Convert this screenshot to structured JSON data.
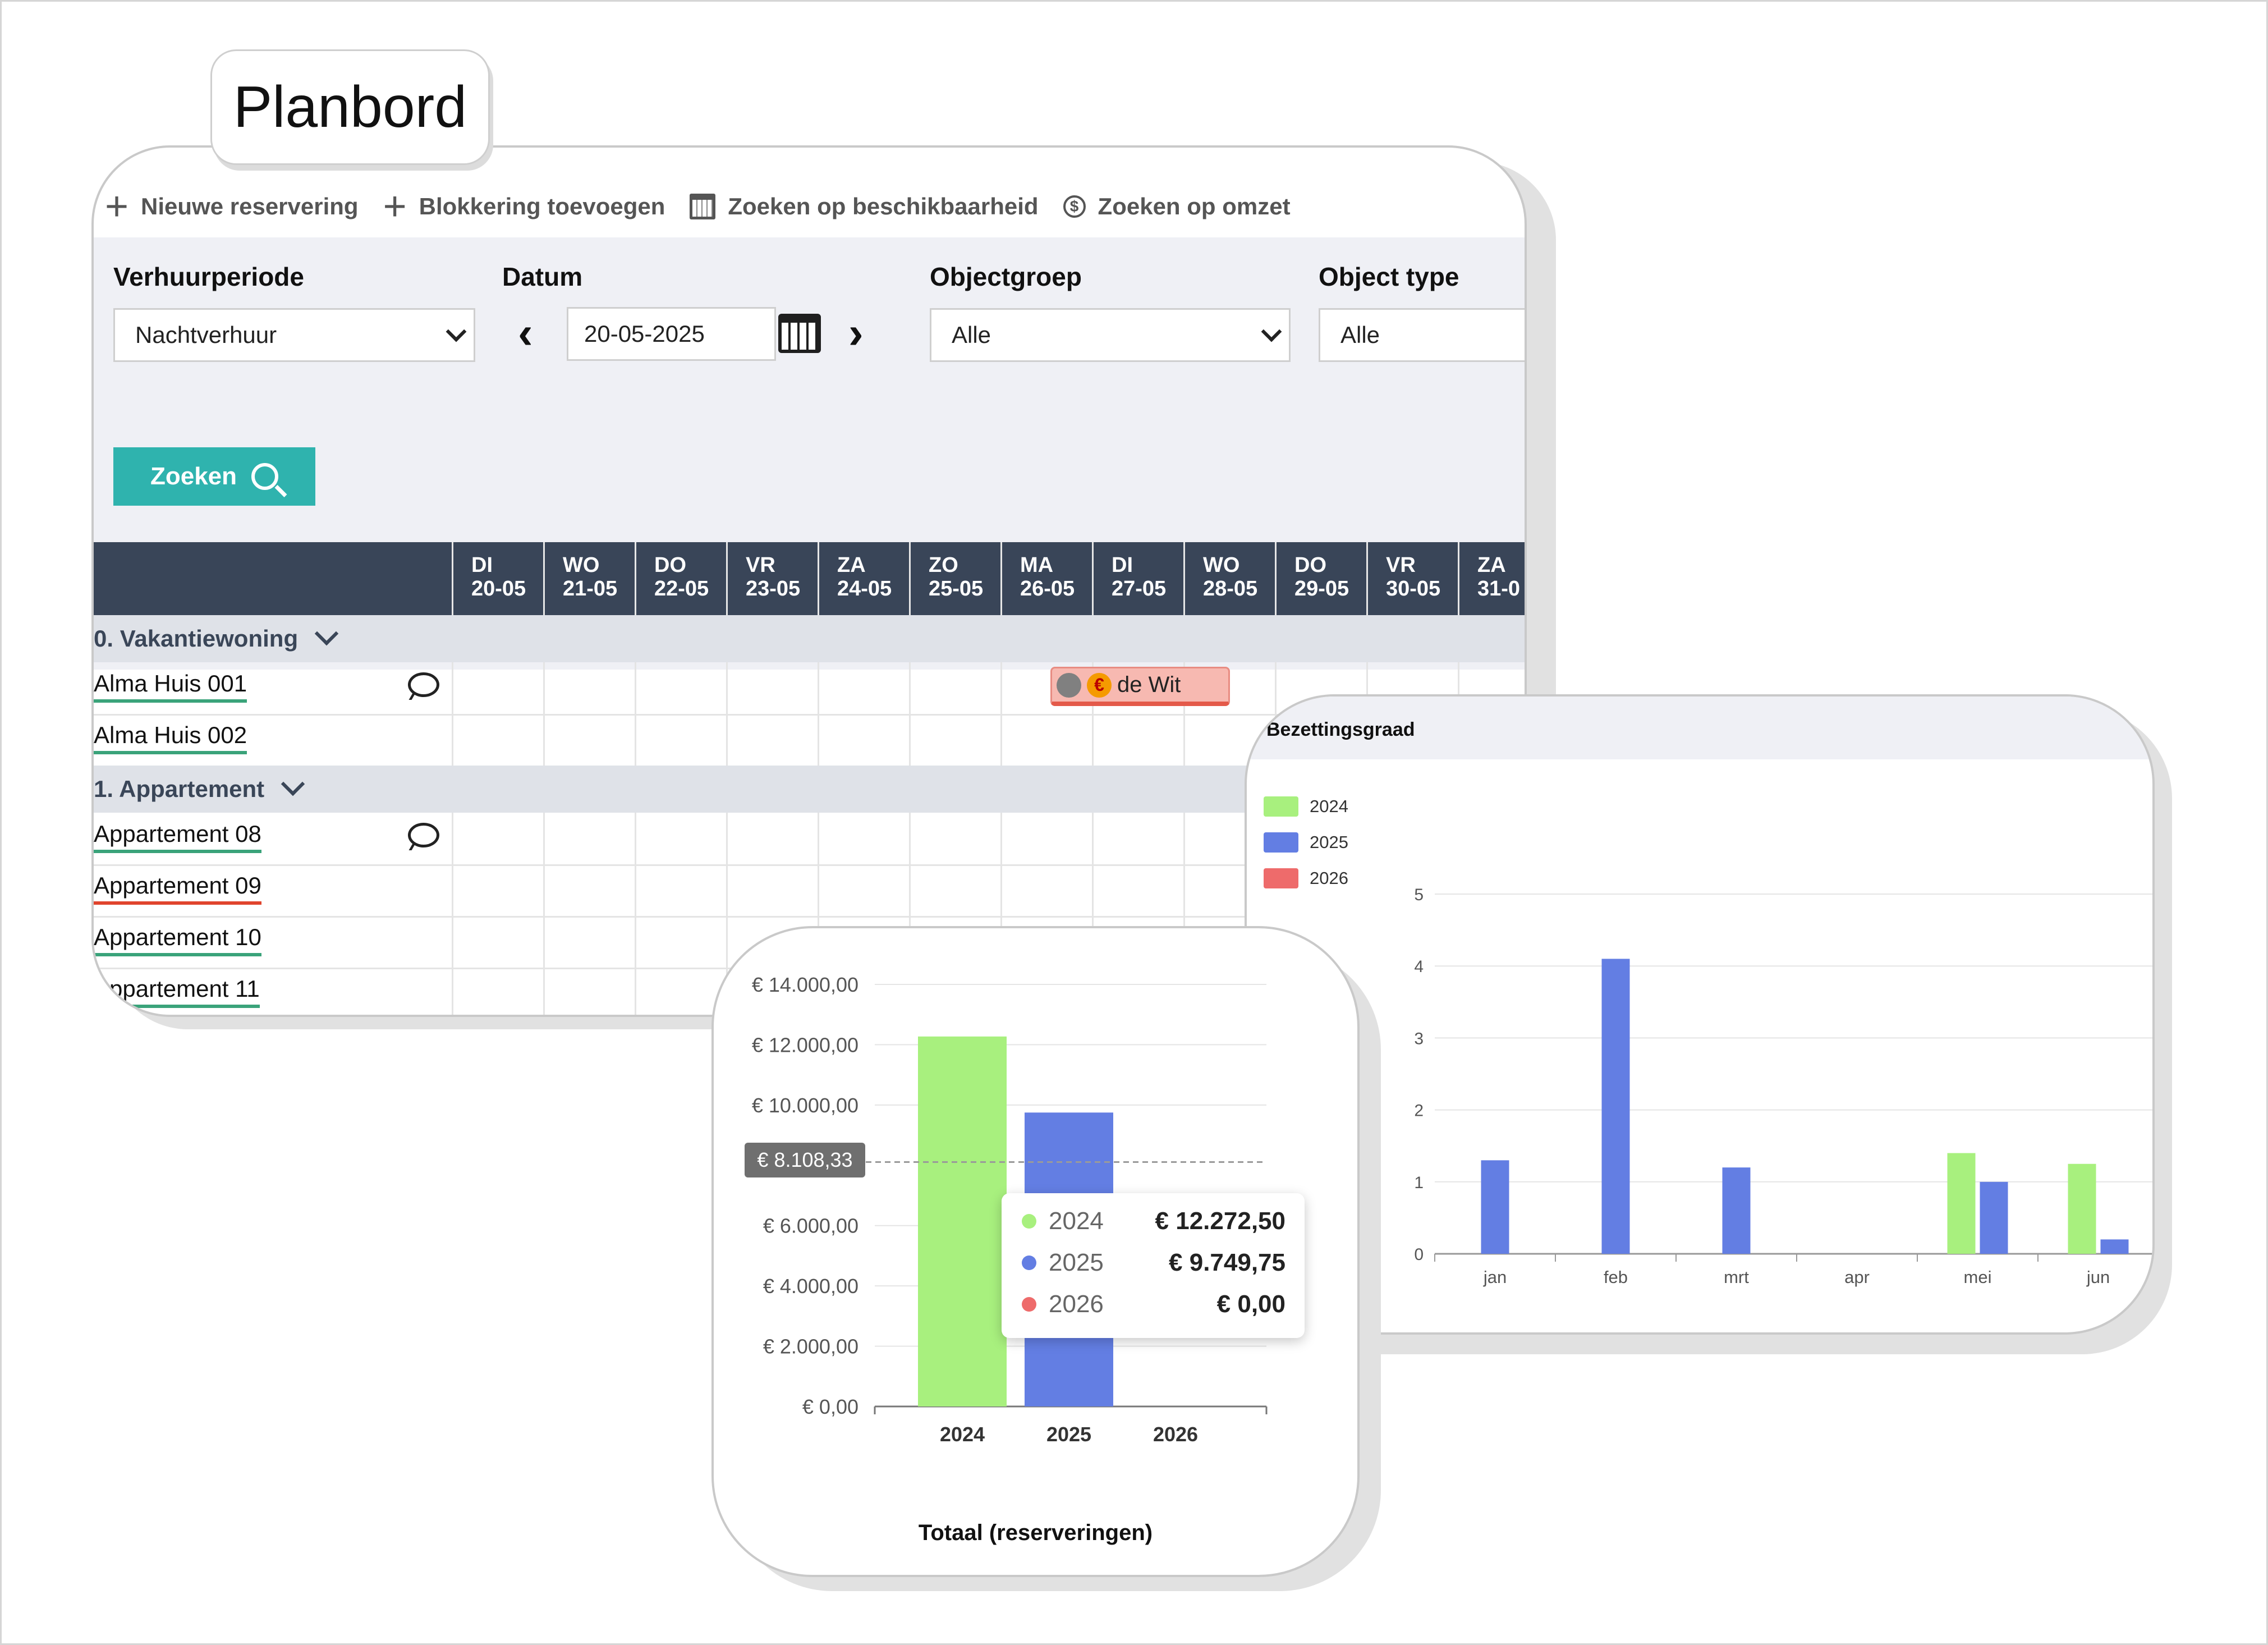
{
  "page": {
    "title": "Planbord"
  },
  "toolbar": [
    {
      "icon": "plus-icon",
      "label": "Nieuwe reservering"
    },
    {
      "icon": "plus-icon",
      "label": "Blokkering toevoegen"
    },
    {
      "icon": "calendar-icon",
      "label": "Zoeken op beschikbaarheid"
    },
    {
      "icon": "dollar-circle-icon",
      "label": "Zoeken op omzet"
    }
  ],
  "filters": {
    "verhuurperiode": {
      "label": "Verhuurperiode",
      "value": "Nachtverhuur"
    },
    "datum": {
      "label": "Datum",
      "value": "20-05-2025"
    },
    "objectgroep": {
      "label": "Objectgroep",
      "value": "Alle"
    },
    "object_type": {
      "label": "Object type",
      "value": "Alle"
    },
    "search_button": "Zoeken"
  },
  "days": [
    {
      "dow": "DI",
      "date": "20-05"
    },
    {
      "dow": "WO",
      "date": "21-05"
    },
    {
      "dow": "DO",
      "date": "22-05"
    },
    {
      "dow": "VR",
      "date": "23-05"
    },
    {
      "dow": "ZA",
      "date": "24-05"
    },
    {
      "dow": "ZO",
      "date": "25-05"
    },
    {
      "dow": "MA",
      "date": "26-05"
    },
    {
      "dow": "DI",
      "date": "27-05"
    },
    {
      "dow": "WO",
      "date": "28-05"
    },
    {
      "dow": "DO",
      "date": "29-05"
    },
    {
      "dow": "VR",
      "date": "30-05"
    },
    {
      "dow": "ZA",
      "date": "31-0"
    }
  ],
  "groups": [
    {
      "name": "0. Vakantiewoning",
      "objects": [
        {
          "name": "Alma Huis 001",
          "status_color": "#3aa37a",
          "has_comment": true
        },
        {
          "name": "Alma Huis 002",
          "status_color": "#3aa37a",
          "has_comment": false
        }
      ]
    },
    {
      "name": "1. Appartement",
      "objects": [
        {
          "name": "Appartement 08",
          "status_color": "#3aa37a",
          "has_comment": true
        },
        {
          "name": "Appartement 09",
          "status_color": "#e0442d",
          "has_comment": false
        },
        {
          "name": "Appartement 10",
          "status_color": "#3aa37a",
          "has_comment": false
        },
        {
          "name": "Appartement 11",
          "status_color": "#3aa37a",
          "has_comment": false
        }
      ]
    }
  ],
  "reservation": {
    "guest": "de Wit"
  },
  "colors": {
    "y2024": "#a8f07e",
    "y2025": "#637ee3",
    "y2026": "#ee6b6b",
    "accent": "#2fb3ae",
    "header": "#394558"
  },
  "occupancy": {
    "title": "Bezettingsgraad",
    "legend": [
      "2024",
      "2025",
      "2026"
    ]
  },
  "revenue": {
    "caption": "Totaal (reserveringen)",
    "reference_label": "€ 8.108,33",
    "tooltip": [
      {
        "year": "2024",
        "value": "€ 12.272,50"
      },
      {
        "year": "2025",
        "value": "€ 9.749,75"
      },
      {
        "year": "2026",
        "value": "€ 0,00"
      }
    ]
  },
  "chart_data": [
    {
      "type": "bar",
      "title": "Bezettingsgraad",
      "categories": [
        "jan",
        "feb",
        "mrt",
        "apr",
        "mei",
        "jun"
      ],
      "series": [
        {
          "name": "2024",
          "values": [
            0,
            0,
            0,
            0,
            1.4,
            1.25
          ]
        },
        {
          "name": "2025",
          "values": [
            1.3,
            4.1,
            1.2,
            0,
            1.0,
            0.2
          ]
        },
        {
          "name": "2026",
          "values": [
            0,
            0,
            0,
            0,
            0,
            0
          ]
        }
      ],
      "yticks": [
        "0",
        "1",
        "2",
        "3",
        "4",
        "5"
      ],
      "ylim": [
        0,
        5
      ],
      "legend_position": "top-left",
      "grid": true
    },
    {
      "type": "bar",
      "title": "Totaal (reserveringen)",
      "categories": [
        "2024",
        "2025",
        "2026"
      ],
      "values": [
        12272.5,
        9749.75,
        0
      ],
      "yticks": [
        "€ 0,00",
        "€ 2.000,00",
        "€ 4.000,00",
        "€ 6.000,00",
        "€ 10.000,00",
        "€ 12.000,00",
        "€ 14.000,00"
      ],
      "ytick_values": [
        0,
        2000,
        4000,
        6000,
        10000,
        12000,
        14000
      ],
      "ylim": [
        0,
        14000
      ],
      "reference_line": 8108.33,
      "grid": true
    }
  ]
}
